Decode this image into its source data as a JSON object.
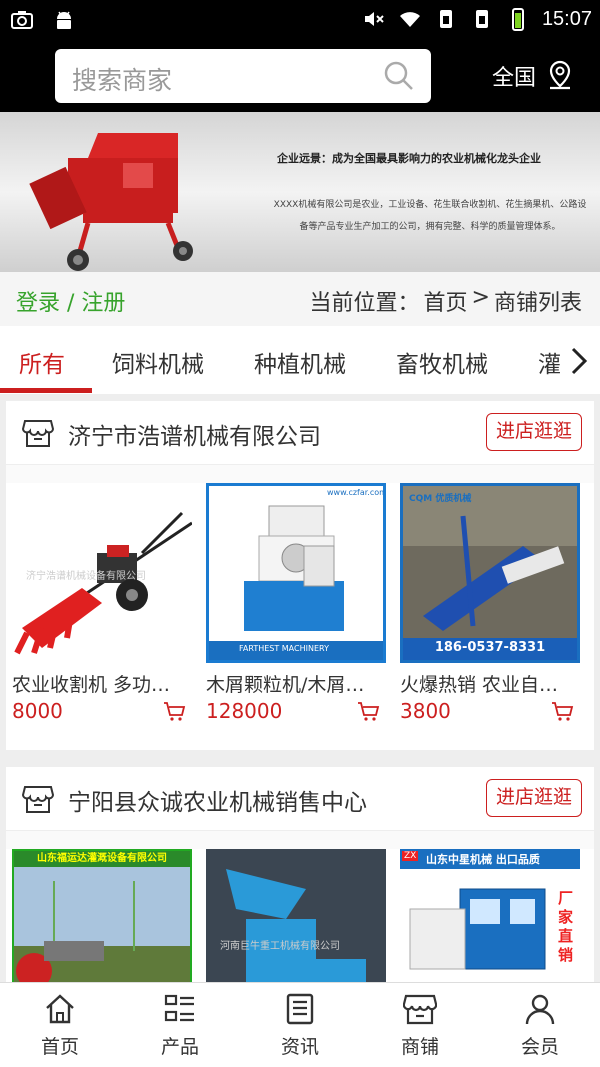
{
  "status_bar": {
    "time": "15:07"
  },
  "header": {
    "search_placeholder": "搜索商家",
    "region": "全国"
  },
  "banner": {
    "slogan": "企业远景：成为全国最具影响力的农业机械化龙头企业",
    "description": "XXXX机械有限公司是农业，工业设备、花生联合收割机、花生摘果机、公路设备等产品专业生产加工的公司，拥有完整、科学的质量管理体系。"
  },
  "breadcrumb": {
    "login": "登录 / 注册",
    "current_label": "当前位置：",
    "home": "首页",
    "separator": ">",
    "page": "商铺列表"
  },
  "tabs": [
    "所有",
    "饲料机械",
    "种植机械",
    "畜牧机械",
    "灌"
  ],
  "stores": [
    {
      "name": "济宁市浩谱机械有限公司",
      "visit_label": "进店逛逛",
      "products": [
        {
          "title": "农业收割机 多功能小型收割机",
          "price": "8000",
          "watermark": "济宁浩谱机械设备有限公司"
        },
        {
          "title": "木屑颗粒机/木屑颗粒机生产线",
          "price": "128000",
          "watermark": "www.czfar.com",
          "caption": "FARTHEST MACHINERY"
        },
        {
          "title": "火爆热销 农业自走式机械",
          "price": "3800",
          "caption": "186-0537-8331",
          "brand": "CQM 优质机械"
        }
      ]
    },
    {
      "name": "宁阳县众诚农业机械销售中心",
      "visit_label": "进店逛逛",
      "products": [
        {
          "banner_text": "山东福运达灌溉设备有限公司"
        },
        {
          "watermark": "河南巨牛重工机械有限公司"
        },
        {
          "banner_text": "山东中星机械 出口品质",
          "badge": "厂家直销",
          "logo": "ZX"
        }
      ]
    }
  ],
  "bottom_nav": [
    "首页",
    "产品",
    "资讯",
    "商铺",
    "会员"
  ],
  "colors": {
    "accent": "#cc1f1f",
    "login_green": "#37a32c",
    "header_bg": "#000000"
  }
}
